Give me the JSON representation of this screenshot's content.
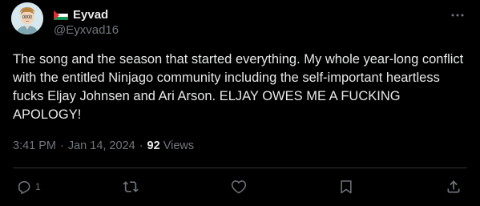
{
  "author": {
    "display_name": "Eyvad",
    "handle": "@Eyxvad16"
  },
  "tweet": {
    "text": "The song and the season that started everything. My whole year-long conflict with the entitled Ninjago community including the self-important heartless fucks Eljay Johnsen and Ari Arson. ELJAY OWES ME A FUCKING APOLOGY!",
    "time": "3:41 PM",
    "date": "Jan 14, 2024",
    "separator": "·",
    "views_count": "92",
    "views_label": "Views"
  },
  "actions": {
    "reply_count": "1"
  },
  "icons": {
    "more": "more-icon",
    "reply": "reply-icon",
    "retweet": "retweet-icon",
    "like": "like-icon",
    "bookmark": "bookmark-icon",
    "share": "share-icon",
    "flag": "palestine-flag-icon"
  },
  "colors": {
    "background": "#000000",
    "text": "#e7e9ea",
    "secondary": "#71767b",
    "divider": "#2f3336"
  }
}
